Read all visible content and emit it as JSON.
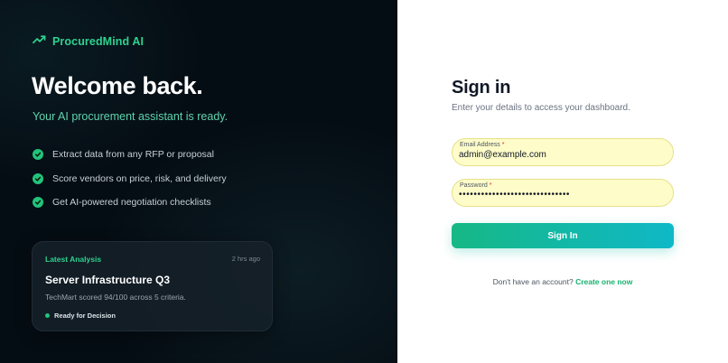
{
  "brand": {
    "name": "ProcuredMind AI",
    "icon": "trending-up-icon",
    "color": "#2ed18f"
  },
  "hero": {
    "title": "Welcome back.",
    "subtitle": "Your AI procurement assistant is ready."
  },
  "features": [
    {
      "text": "Extract data from any RFP or proposal",
      "icon": "check-circle-icon"
    },
    {
      "text": "Score vendors on price, risk, and delivery",
      "icon": "check-circle-icon"
    },
    {
      "text": "Get AI-powered negotiation checklists",
      "icon": "check-circle-icon"
    }
  ],
  "analysis_card": {
    "label": "Latest Analysis",
    "time": "2 hrs ago",
    "title": "Server Infrastructure Q3",
    "description": "TechMart scored 94/100 across 5 criteria.",
    "status": "Ready for Decision",
    "status_color": "#22c47a"
  },
  "signin": {
    "title": "Sign in",
    "subtitle": "Enter your details to access your dashboard.",
    "email": {
      "label": "Email Address",
      "required_mark": "*",
      "value": "admin@example.com"
    },
    "password": {
      "label": "Password",
      "required_mark": "*",
      "value": "••••••••••••••••••••••••••••••"
    },
    "button_label": "Sign In",
    "signup_prompt": "Don't have an account?",
    "signup_link": "Create one now"
  },
  "colors": {
    "accent": "#16b885",
    "accent_end": "#0fb8c7",
    "left_bg": "#050d14",
    "input_bg": "#fefcc8"
  }
}
